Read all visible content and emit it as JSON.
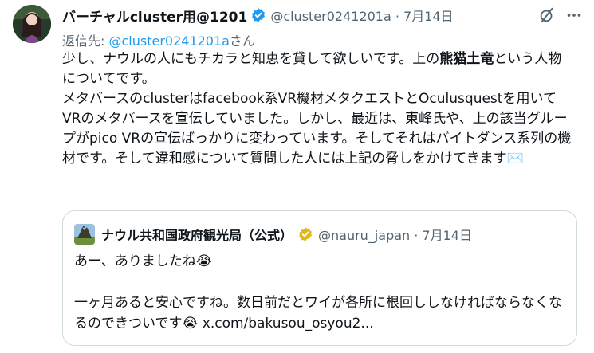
{
  "tweet": {
    "display_name": "バーチャルcluster用@1201",
    "handle_date": "@cluster0241201a · 7月14日",
    "reply_prefix": "返信先: ",
    "reply_mention": "@cluster0241201a",
    "reply_suffix": "さん",
    "text": {
      "p1_a": "少し、ナウルの人にもチカラと知恵を貸して欲しいです。上の",
      "p1_bold": "熊猫土竜",
      "p1_b": "という人物についてです。",
      "p2": "メタバースのclusterはfacebook系VR機材メタクエストとOculusquestを用いてVRのメタバースを宣伝していました。しかし、最近は、東峰氏や、上の該当グループがpico VRの宣伝ばっかりに変わっています。そしてそれはバイトダンス系列の機材です。そして違和感について質問した人には上記の脅しをかけてきます",
      "p2_emoji": "✉️"
    }
  },
  "icons": {
    "verified": "verified-badge-icon",
    "grok": "grok-icon",
    "more": "more-icon",
    "quote_verified": "gold-verified-badge-icon"
  },
  "quote": {
    "display_name": "ナウル共和国政府観光局（公式）",
    "handle_date": "@nauru_japan · 7月14日",
    "line1": "あー、ありましたね😭",
    "line2": "一ヶ月あると安心ですね。数日前だとワイが各所に根回ししなければならなくなるのできついです😭 ",
    "link": "x.com/bakusou_osyou2..."
  },
  "colors": {
    "text": "#0f1419",
    "secondary": "#536471",
    "accent": "#1d9bf0",
    "border": "#cfd9de",
    "gold": "#e2b719"
  }
}
